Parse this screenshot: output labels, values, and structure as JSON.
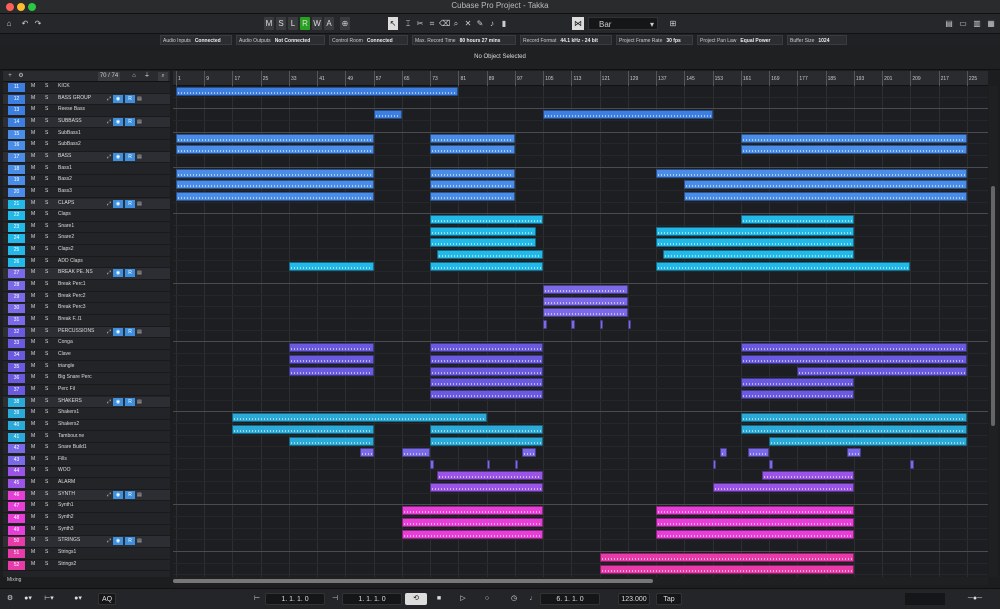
{
  "window": {
    "title": "Cubase Pro Project - Takka"
  },
  "toolbar": {
    "mode_buttons": [
      "M",
      "S",
      "L",
      "R",
      "W",
      "A"
    ],
    "snap_value": "Bar"
  },
  "status": {
    "items": [
      {
        "label": "Audio Inputs",
        "value": "Connected"
      },
      {
        "label": "Audio Outputs",
        "value": "Not Connected"
      },
      {
        "label": "Control Room",
        "value": "Connected"
      },
      {
        "label": "Max. Record Time",
        "value": "80 hours 27 mins"
      },
      {
        "label": "Record Format",
        "value": "44.1 kHz - 24 bit"
      },
      {
        "label": "Project Frame Rate",
        "value": "30 fps"
      },
      {
        "label": "Project Pan Law",
        "value": "Equal Power"
      },
      {
        "label": "Buffer Size",
        "value": "1024"
      }
    ]
  },
  "info_line": "No Object Selected",
  "tracklist_header": {
    "counter": "70 / 74"
  },
  "ruler": {
    "bars": [
      "1",
      "9",
      "17",
      "25",
      "33",
      "41",
      "49",
      "57",
      "65",
      "73",
      "81",
      "89",
      "97",
      "105",
      "113",
      "121",
      "129",
      "137",
      "145",
      "153",
      "161",
      "169",
      "177",
      "185",
      "193",
      "201",
      "209",
      "217",
      "225"
    ]
  },
  "colors": {
    "kick": "#3d7fe0",
    "bass": "#4a8de8",
    "claps": "#22b8e8",
    "break": "#7a6ae8",
    "perc": "#6a5ae0",
    "shakers": "#2aaad8",
    "fx": "#9a55e8",
    "synth": "#e83ed8",
    "strings": "#e83aa8"
  },
  "tracks": [
    {
      "num": "11",
      "name": "KICK",
      "folder": false,
      "color": "kick"
    },
    {
      "num": "12",
      "name": "BASS GROUP",
      "folder": true,
      "color": "kick"
    },
    {
      "num": "13",
      "name": "Reese Bass",
      "folder": false,
      "color": "kick"
    },
    {
      "num": "14",
      "name": "SUBBASS",
      "folder": true,
      "color": "kick"
    },
    {
      "num": "15",
      "name": "SubBass1",
      "folder": false,
      "color": "bass"
    },
    {
      "num": "16",
      "name": "SubBass2",
      "folder": false,
      "color": "bass"
    },
    {
      "num": "17",
      "name": "BASS",
      "folder": true,
      "color": "bass"
    },
    {
      "num": "18",
      "name": "Bass1",
      "folder": false,
      "color": "bass"
    },
    {
      "num": "19",
      "name": "Bass2",
      "folder": false,
      "color": "bass"
    },
    {
      "num": "20",
      "name": "Bass3",
      "folder": false,
      "color": "bass"
    },
    {
      "num": "21",
      "name": "CLAPS",
      "folder": true,
      "color": "claps"
    },
    {
      "num": "22",
      "name": "Claps",
      "folder": false,
      "color": "claps"
    },
    {
      "num": "23",
      "name": "Snare1",
      "folder": false,
      "color": "claps"
    },
    {
      "num": "24",
      "name": "Snare2",
      "folder": false,
      "color": "claps"
    },
    {
      "num": "25",
      "name": "Claps2",
      "folder": false,
      "color": "claps"
    },
    {
      "num": "26",
      "name": "ADD Claps",
      "folder": false,
      "color": "claps"
    },
    {
      "num": "27",
      "name": "BREAK PE..NS",
      "folder": true,
      "color": "break"
    },
    {
      "num": "28",
      "name": "Break Perc1",
      "folder": false,
      "color": "break"
    },
    {
      "num": "29",
      "name": "Break Perc2",
      "folder": false,
      "color": "break"
    },
    {
      "num": "30",
      "name": "Break Perc3",
      "folder": false,
      "color": "break"
    },
    {
      "num": "31",
      "name": "Break F..l1",
      "folder": false,
      "color": "break"
    },
    {
      "num": "32",
      "name": "PERCUSSIONS",
      "folder": true,
      "color": "perc"
    },
    {
      "num": "33",
      "name": "Conga",
      "folder": false,
      "color": "perc"
    },
    {
      "num": "34",
      "name": "Clave",
      "folder": false,
      "color": "perc"
    },
    {
      "num": "35",
      "name": "triangle",
      "folder": false,
      "color": "perc"
    },
    {
      "num": "36",
      "name": "Big Snare Perc",
      "folder": false,
      "color": "perc"
    },
    {
      "num": "37",
      "name": "Perc Fil",
      "folder": false,
      "color": "perc"
    },
    {
      "num": "38",
      "name": "SHAKERS",
      "folder": true,
      "color": "shakers"
    },
    {
      "num": "39",
      "name": "Shakers1",
      "folder": false,
      "color": "shakers"
    },
    {
      "num": "40",
      "name": "Shakers2",
      "folder": false,
      "color": "shakers"
    },
    {
      "num": "41",
      "name": "Tambour.ne",
      "folder": false,
      "color": "shakers"
    },
    {
      "num": "42",
      "name": "Snare Build1",
      "folder": false,
      "color": "break"
    },
    {
      "num": "43",
      "name": "Fills",
      "folder": false,
      "color": "break"
    },
    {
      "num": "44",
      "name": "WOO",
      "folder": false,
      "color": "fx"
    },
    {
      "num": "45",
      "name": "ALARM",
      "folder": false,
      "color": "fx"
    },
    {
      "num": "46",
      "name": "SYNTH",
      "folder": true,
      "color": "synth"
    },
    {
      "num": "47",
      "name": "Synth1",
      "folder": false,
      "color": "synth"
    },
    {
      "num": "48",
      "name": "Synth2",
      "folder": false,
      "color": "synth"
    },
    {
      "num": "49",
      "name": "Synth3",
      "folder": false,
      "color": "synth"
    },
    {
      "num": "50",
      "name": "STRINGS",
      "folder": true,
      "color": "strings"
    },
    {
      "num": "51",
      "name": "Strings1",
      "folder": false,
      "color": "strings"
    },
    {
      "num": "52",
      "name": "Strings2",
      "folder": false,
      "color": "strings"
    }
  ],
  "clips": [
    [
      [
        1,
        81
      ]
    ],
    [],
    [
      [
        57,
        65
      ],
      [
        105,
        153
      ]
    ],
    [],
    [
      [
        1,
        57
      ],
      [
        73,
        97
      ],
      [
        161,
        225
      ]
    ],
    [
      [
        1,
        57
      ],
      [
        73,
        97
      ],
      [
        161,
        225
      ]
    ],
    [],
    [
      [
        1,
        57
      ],
      [
        73,
        97
      ],
      [
        137,
        225
      ]
    ],
    [
      [
        1,
        57
      ],
      [
        73,
        97
      ],
      [
        145,
        225
      ]
    ],
    [
      [
        1,
        57
      ],
      [
        73,
        97
      ],
      [
        145,
        225
      ]
    ],
    [],
    [
      [
        73,
        105
      ],
      [
        161,
        193
      ]
    ],
    [
      [
        73,
        103
      ],
      [
        137,
        193
      ]
    ],
    [
      [
        73,
        103
      ],
      [
        137,
        193
      ]
    ],
    [
      [
        75,
        105
      ],
      [
        139,
        193
      ]
    ],
    [
      [
        33,
        57
      ],
      [
        73,
        105
      ],
      [
        137,
        209
      ]
    ],
    [],
    [
      [
        105,
        129
      ]
    ],
    [
      [
        105,
        129
      ]
    ],
    [
      [
        105,
        129
      ]
    ],
    [
      [
        105,
        106
      ],
      [
        113,
        114
      ],
      [
        121,
        122
      ],
      [
        129,
        130
      ]
    ],
    [],
    [
      [
        33,
        57
      ],
      [
        73,
        105
      ],
      [
        161,
        225
      ]
    ],
    [
      [
        33,
        57
      ],
      [
        73,
        105
      ],
      [
        161,
        225
      ]
    ],
    [
      [
        33,
        57
      ],
      [
        73,
        105
      ],
      [
        177,
        225
      ]
    ],
    [
      [
        73,
        105
      ],
      [
        161,
        193
      ]
    ],
    [
      [
        73,
        105
      ],
      [
        161,
        193
      ]
    ],
    [],
    [
      [
        17,
        89
      ],
      [
        161,
        225
      ]
    ],
    [
      [
        17,
        57
      ],
      [
        73,
        105
      ],
      [
        161,
        225
      ]
    ],
    [
      [
        33,
        57
      ],
      [
        73,
        105
      ],
      [
        169,
        225
      ]
    ],
    [
      [
        53,
        57
      ],
      [
        65,
        73
      ],
      [
        99,
        103
      ],
      [
        155,
        157
      ],
      [
        163,
        169
      ],
      [
        191,
        195
      ]
    ],
    [
      [
        73,
        74
      ],
      [
        89,
        90
      ],
      [
        97,
        98
      ],
      [
        153,
        154
      ],
      [
        169,
        170
      ],
      [
        209,
        210
      ]
    ],
    [
      [
        75,
        105
      ],
      [
        167,
        193
      ]
    ],
    [
      [
        73,
        105
      ],
      [
        153,
        193
      ]
    ],
    [],
    [
      [
        65,
        105
      ],
      [
        137,
        193
      ]
    ],
    [
      [
        65,
        105
      ],
      [
        137,
        193
      ]
    ],
    [
      [
        65,
        105
      ],
      [
        137,
        193
      ]
    ],
    [],
    [
      [
        121,
        193
      ]
    ],
    [
      [
        121,
        193
      ]
    ]
  ],
  "transport": {
    "left_time": "1. 1. 1.  0",
    "right_time": "1. 1. 1.  0",
    "position": "6. 1. 1.  0",
    "tempo": "123.000",
    "tap": "Tap",
    "mode": "AQ"
  },
  "footer": {
    "mixing": "Mixing"
  }
}
